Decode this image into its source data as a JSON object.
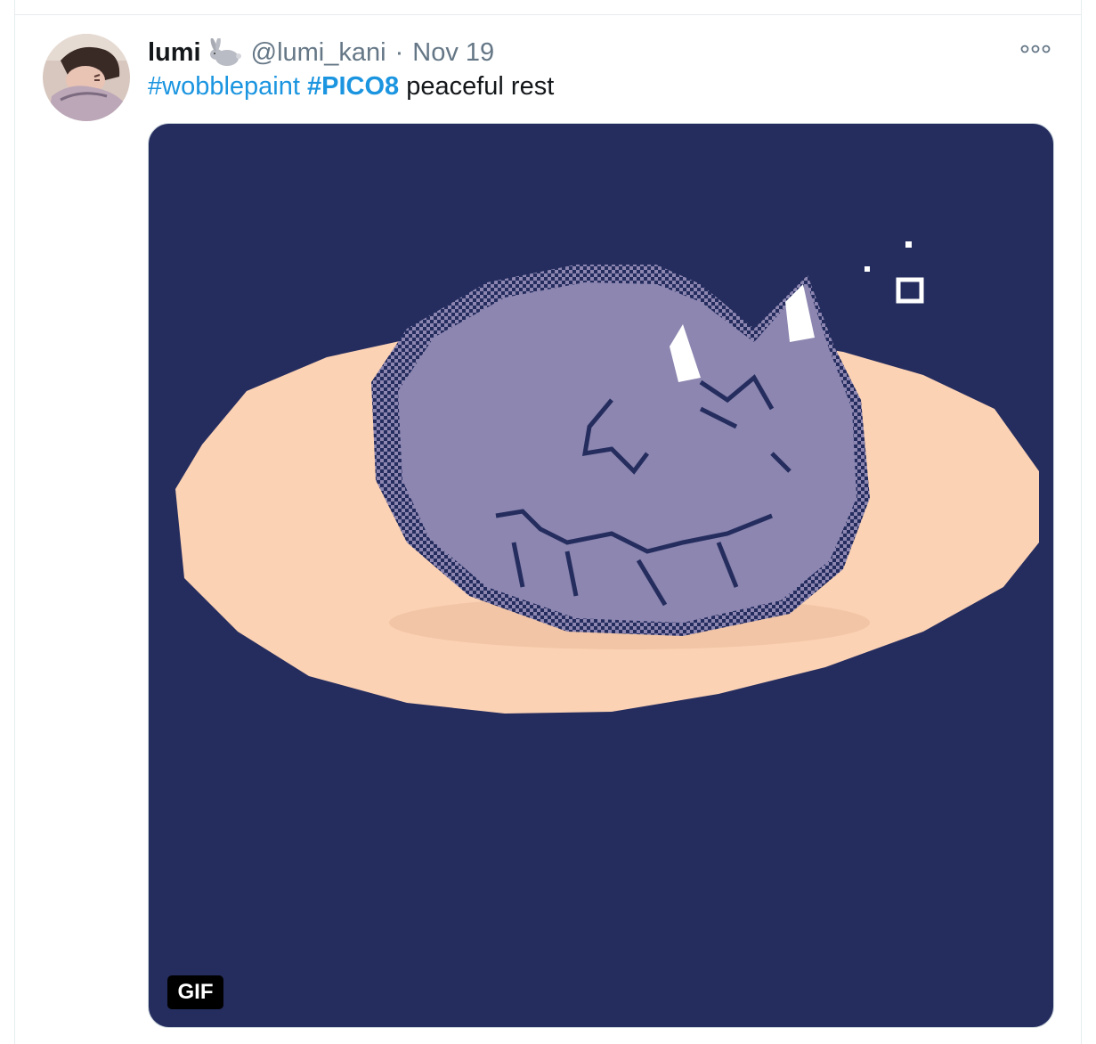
{
  "tweet": {
    "display_name": "lumi",
    "name_emoji": "rabbit-icon",
    "handle": "@lumi_kani",
    "separator": "·",
    "timestamp": "Nov 19",
    "text": {
      "hashtag1": "#wobblepaint",
      "hashtag2": "#PICO8",
      "body": "peaceful rest"
    },
    "media": {
      "badge": "GIF",
      "background_color": "#252d5f",
      "rug_color": "#fcd2b4",
      "cat_color": "#8c86b0"
    }
  },
  "colors": {
    "link": "#1b95e0",
    "text": "#14171a",
    "muted": "#657786"
  }
}
